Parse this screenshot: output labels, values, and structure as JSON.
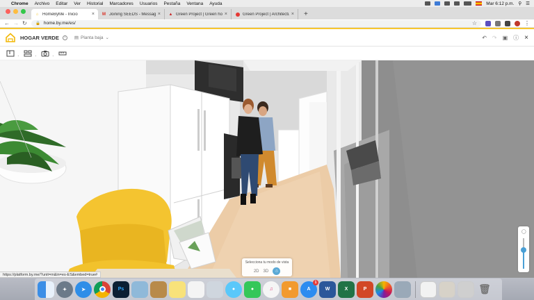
{
  "menubar": {
    "items": [
      "Chrome",
      "Archivo",
      "Editar",
      "Ver",
      "Historial",
      "Marcadores",
      "Usuarios",
      "Pestaña",
      "Ventana",
      "Ayuda"
    ],
    "clock": "Mar 6:12 p.m."
  },
  "tabs": [
    {
      "title": "HomeByMe - Inicio",
      "favicon": "homebyme-icon",
      "active": true
    },
    {
      "title": "Joining SEEDS - Message from",
      "favicon": "gmail-icon",
      "active": false
    },
    {
      "title": "Green Project | Green home",
      "favicon": "green-project-icon",
      "active": false
    },
    {
      "title": "Green Project | Architecture in",
      "favicon": "red-circle-icon",
      "active": false
    }
  ],
  "address": {
    "url": "home.by.me/es/"
  },
  "app": {
    "project_name": "HOGAR VERDE",
    "floor": "Planta baja",
    "colors": {
      "accent": "#f7c72f",
      "view_blue": "#4a9fd5"
    }
  },
  "viewmode": {
    "title": "Selecciona tu modo de vista",
    "option_2d": "2D",
    "option_3d": "3D"
  },
  "zoom": {
    "level": 0.65
  },
  "status_url": "https://platform.by.me/?unit=m&in=es-ES&embed=true#",
  "dock": {
    "apps": [
      "Finder",
      "Launchpad",
      "Safari",
      "Chrome",
      "Photoshop",
      "Preview",
      "Notebook",
      "Notes",
      "TextEdit",
      "Photo Booth",
      "Messages",
      "FaceTime",
      "iTunes",
      "iBooks",
      "App Store",
      "Word",
      "Excel",
      "PowerPoint",
      "Photos",
      "Image Capture"
    ],
    "appstore_badge": "1"
  }
}
